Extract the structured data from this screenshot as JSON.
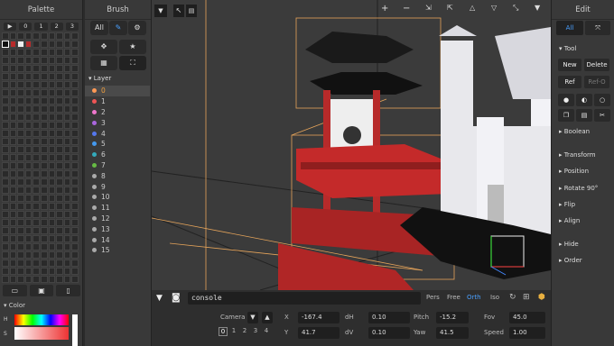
{
  "palette": {
    "title": "Palette",
    "tabs": [
      "▶",
      "0",
      "1",
      "2",
      "3"
    ],
    "bottom_icons": [
      "folder-icon",
      "save-icon",
      "file-icon"
    ],
    "color_section": "Color",
    "h_label": "H",
    "s_label": "S"
  },
  "brush": {
    "title": "Brush",
    "all_label": "All",
    "layer_header": "Layer",
    "layers": [
      {
        "label": "0",
        "color": "#ff9955"
      },
      {
        "label": "1",
        "color": "#ee5555"
      },
      {
        "label": "2",
        "color": "#ee77cc"
      },
      {
        "label": "3",
        "color": "#aa66dd"
      },
      {
        "label": "4",
        "color": "#5577ee"
      },
      {
        "label": "5",
        "color": "#4499ee"
      },
      {
        "label": "6",
        "color": "#33aabb"
      },
      {
        "label": "7",
        "color": "#66bb44"
      },
      {
        "label": "8",
        "color": "#aaaaaa"
      },
      {
        "label": "9",
        "color": "#aaaaaa"
      },
      {
        "label": "10",
        "color": "#aaaaaa"
      },
      {
        "label": "11",
        "color": "#aaaaaa"
      },
      {
        "label": "12",
        "color": "#aaaaaa"
      },
      {
        "label": "13",
        "color": "#aaaaaa"
      },
      {
        "label": "14",
        "color": "#aaaaaa"
      },
      {
        "label": "15",
        "color": "#aaaaaa"
      }
    ]
  },
  "edit": {
    "title": "Edit",
    "all_label": "All",
    "tool_header": "Tool",
    "new_label": "New",
    "delete_label": "Delete",
    "ref_label": "Ref",
    "refo_label": "Ref-O",
    "sections": [
      "Boolean",
      "Transform",
      "Position",
      "Rotate 90°",
      "Flip",
      "Align",
      "Hide",
      "Order"
    ]
  },
  "console": {
    "placeholder": "console",
    "views": [
      "Pers",
      "Free",
      "Orth",
      "Iso"
    ],
    "active_view": "Orth",
    "camera_label": "Camera",
    "cam_tabs": [
      "0",
      "1",
      "2",
      "3",
      "4"
    ],
    "fields": [
      {
        "label": "X",
        "value": "-167.4"
      },
      {
        "label": "dH",
        "value": "0.10"
      },
      {
        "label": "Pitch",
        "value": "-15.2"
      },
      {
        "label": "Fov",
        "value": "45.0"
      },
      {
        "label": "Y",
        "value": "41.7"
      },
      {
        "label": "dV",
        "value": "0.10"
      },
      {
        "label": "Yaw",
        "value": "41.5"
      },
      {
        "label": "Speed",
        "value": "1.00"
      }
    ]
  },
  "colors": {
    "accent": "#4aa0ff",
    "selected_red": "#b72a2a"
  }
}
